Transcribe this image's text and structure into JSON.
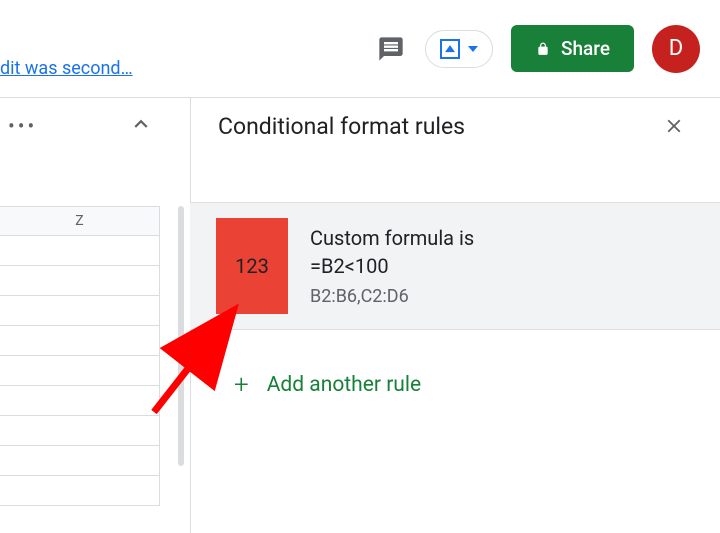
{
  "top": {
    "edit_hint": "dit was second…",
    "share_label": "Share",
    "avatar_initial": "D"
  },
  "panel": {
    "title": "Conditional format rules"
  },
  "sheet": {
    "column": "Z"
  },
  "rule": {
    "swatch_text": "123",
    "title": "Custom formula is",
    "formula": "=B2<100",
    "range": "B2:B6,C2:D6"
  },
  "add_rule": {
    "label": "Add another rule"
  }
}
